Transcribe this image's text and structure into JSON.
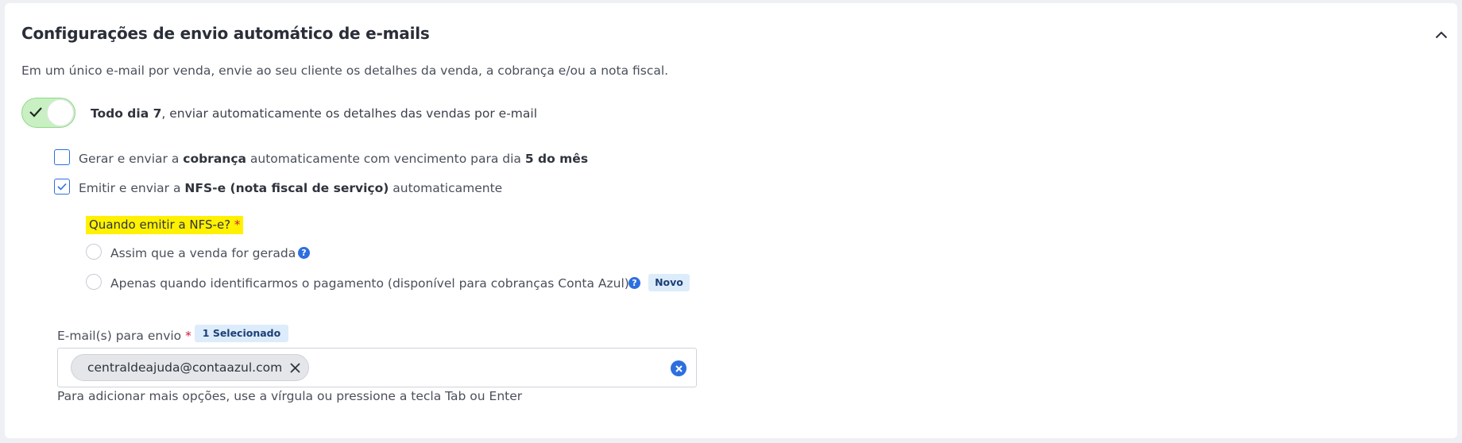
{
  "section": {
    "title": "Configurações de envio automático de e-mails",
    "description": "Em um único e-mail por venda, envie ao seu cliente os detalhes da venda, a cobrança e/ou a nota fiscal."
  },
  "auto_send": {
    "enabled": true,
    "label_bold": "Todo dia 7",
    "label_rest": ", enviar automaticamente os detalhes das vendas por e-mail"
  },
  "options": {
    "billing": {
      "checked": false,
      "part1": "Gerar e enviar a ",
      "bold1": "cobrança",
      "part2": " automaticamente com vencimento para dia ",
      "bold2": "5 do mês"
    },
    "nfse": {
      "checked": true,
      "part1": "Emitir e enviar a ",
      "bold1": "NFS-e (nota fiscal de serviço)",
      "part2": " automaticamente"
    }
  },
  "nfse_when": {
    "question": "Quando emitir a NFS-e?",
    "required_mark": "*",
    "options": [
      {
        "label": "Assim que a venda for gerada",
        "selected": false
      },
      {
        "label": "Apenas quando identificarmos o pagamento (disponível para cobranças Conta Azul)",
        "selected": false,
        "badge": "Novo"
      }
    ]
  },
  "emails": {
    "label": "E-mail(s) para envio",
    "required_mark": "*",
    "selected_badge": "1 Selecionado",
    "chips": [
      "centraldeajuda@contaazul.com"
    ],
    "hint": "Para adicionar mais opções, use a vírgula ou pressione a tecla Tab ou Enter"
  },
  "help_glyph": "?",
  "colors": {
    "accent": "#2d6fdf",
    "toggle_on": "#c9f0c3",
    "highlight": "#fff100",
    "required": "#d0173f"
  }
}
